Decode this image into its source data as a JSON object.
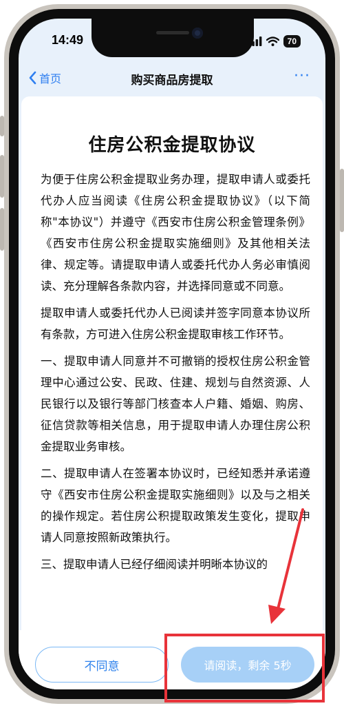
{
  "status_bar": {
    "time": "14:49",
    "battery": "70"
  },
  "nav": {
    "back_label": "首页",
    "title": "购买商品房提取",
    "more_label": "···"
  },
  "document": {
    "title": "住房公积金提取协议",
    "paragraphs": [
      "为便于住房公积金提取业务办理，提取申请人或委托代办人应当阅读《住房公积金提取协议》（以下简称\"本协议\"）并遵守《西安市住房公积金管理条例》《西安市住房公积金提取实施细则》及其他相关法律、规定等。请提取申请人或委托代办人务必审慎阅读、充分理解各条款内容，并选择同意或不同意。",
      "提取申请人或委托代办人已阅读并签字同意本协议所有条款，方可进入住房公积金提取审核工作环节。",
      "一、提取申请人同意并不可撤销的授权住房公积金管理中心通过公安、民政、住建、规划与自然资源、人民银行以及银行等部门核查本人户籍、婚姻、购房、征信贷款等相关信息，用于提取申请人办理住房公积金提取业务审核。",
      "二、提取申请人在签署本协议时，已经知悉并承诺遵守《西安市住房公积金提取实施细则》以及与之相关的操作规定。若住房公积提取政策发生变化，提取申请人同意按照新政策执行。",
      "三、提取申请人已经仔细阅读并明晰本协议的"
    ]
  },
  "buttons": {
    "disagree": "不同意",
    "agree_countdown": "请阅读，剩余 5秒"
  },
  "colors": {
    "accent": "#2f7ff0",
    "annotation": "#e8333a",
    "agree_disabled": "#a7d0f7"
  }
}
